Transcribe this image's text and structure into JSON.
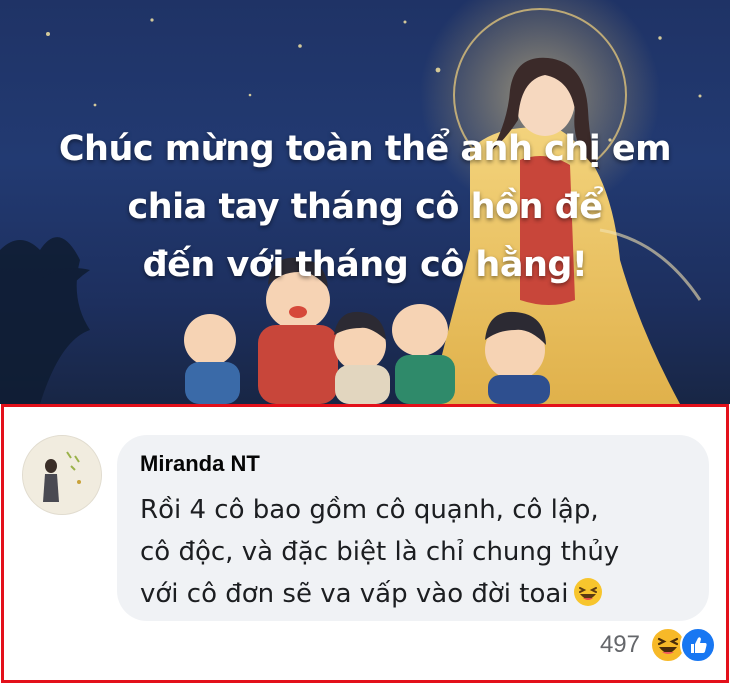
{
  "banner": {
    "lines": [
      "Chúc mừng toàn thể anh chị em",
      "chia tay tháng cô hồn để",
      "đến với tháng cô hằng!"
    ]
  },
  "comment": {
    "author": "Miranda NT",
    "lines": [
      "Rồi 4 cô bao gồm cô quạnh, cô lập,",
      "cô độc, và đặc biệt là chỉ chung thủy",
      "với cô đơn sẽ va vấp vào đời toai"
    ],
    "inline_emoji": "laughing-emoji-icon",
    "reaction_count": "497",
    "reactions": [
      "haha-reaction-icon",
      "like-reaction-icon"
    ]
  },
  "colors": {
    "frame_border": "#e3101a",
    "bubble_bg": "#f0f2f5",
    "like_blue": "#1877f2",
    "haha_yellow": "#f7b928",
    "banner_bg": "#1f3366"
  }
}
